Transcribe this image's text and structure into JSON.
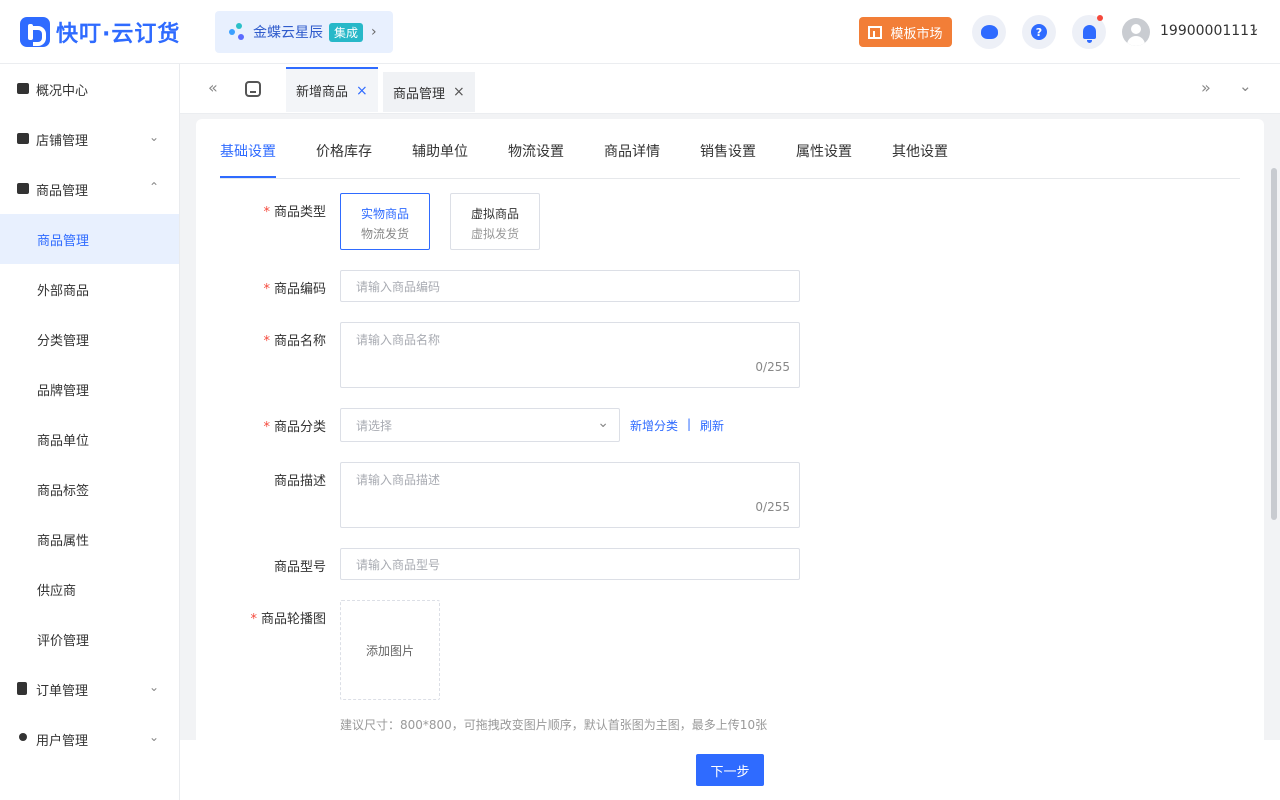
{
  "app": {
    "logo_text": "快叮·云订货",
    "kingdee_label": "金蝶云星辰",
    "kingdee_badge": "集成",
    "kingdee_arrow": "›",
    "market_label": "模板市场",
    "help_symbol": "?",
    "username": "19900001111",
    "user_caret": "⌄",
    "icons": [
      "logo-icon",
      "kingdee-icon",
      "template-icon",
      "service-icon",
      "help-icon",
      "bell-icon",
      "avatar-icon"
    ],
    "colors": {
      "primary": "#2f6bff",
      "market": "#f27e37",
      "badge": "#27b8c8",
      "required": "#f5483b"
    }
  },
  "sidebar": {
    "items": [
      {
        "label": "概况中心"
      },
      {
        "label": "店铺管理",
        "caret": "⌄"
      },
      {
        "label": "商品管理",
        "caret": "⌃"
      },
      {
        "label": "商品管理"
      },
      {
        "label": "外部商品"
      },
      {
        "label": "分类管理"
      },
      {
        "label": "品牌管理"
      },
      {
        "label": "商品单位"
      },
      {
        "label": "商品标签"
      },
      {
        "label": "商品属性"
      },
      {
        "label": "供应商"
      },
      {
        "label": "评价管理"
      },
      {
        "label": "订单管理",
        "caret": "⌄"
      },
      {
        "label": "用户管理",
        "caret": "⌄"
      }
    ]
  },
  "tabs_bar": {
    "prev": "«",
    "next": "»",
    "dropdown": "⌄",
    "tabs": [
      {
        "label": "新增商品",
        "close": "×"
      },
      {
        "label": "商品管理",
        "close": "×"
      }
    ]
  },
  "form_tabs": [
    "基础设置",
    "价格库存",
    "辅助单位",
    "物流设置",
    "商品详情",
    "销售设置",
    "属性设置",
    "其他设置"
  ],
  "form": {
    "required_mark": "*",
    "type": {
      "label": "商品类型",
      "options": [
        {
          "title": "实物商品",
          "sub": "物流发货",
          "selected": true
        },
        {
          "title": "虚拟商品",
          "sub": "虚拟发货",
          "selected": false
        }
      ]
    },
    "code": {
      "label": "商品编码",
      "placeholder": "请输入商品编码"
    },
    "name": {
      "label": "商品名称",
      "placeholder": "请输入商品名称",
      "counter": "0/255"
    },
    "category": {
      "label": "商品分类",
      "placeholder": "请选择",
      "caret": "⌄",
      "add_link": "新增分类",
      "separator": "|",
      "refresh_link": "刷新"
    },
    "description": {
      "label": "商品描述",
      "placeholder": "请输入商品描述",
      "counter": "0/255"
    },
    "model": {
      "label": "商品型号",
      "placeholder": "请输入商品型号"
    },
    "carousel": {
      "label": "商品轮播图",
      "upload_label": "添加图片",
      "hint": "建议尺寸：800*800，可拖拽改变图片顺序，默认首张图为主图，最多上传10张"
    }
  },
  "footer": {
    "next_label": "下一步"
  }
}
